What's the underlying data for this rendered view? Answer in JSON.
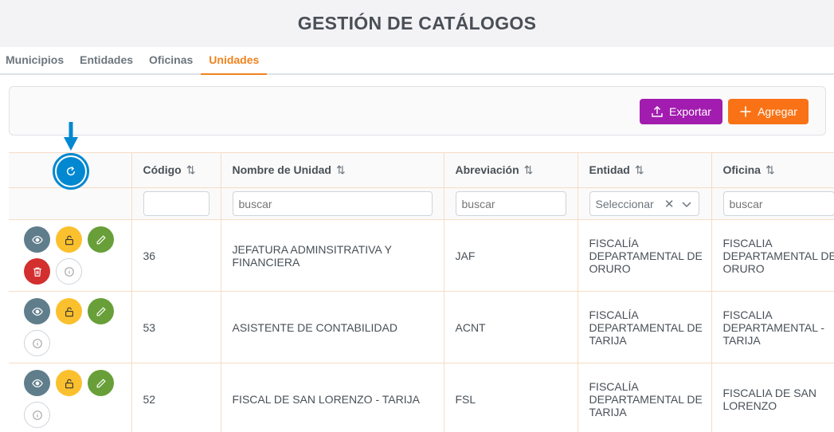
{
  "header": {
    "title": "GESTIÓN DE CATÁLOGOS"
  },
  "tabs": [
    {
      "label": "Municipios",
      "active": false
    },
    {
      "label": "Entidades",
      "active": false
    },
    {
      "label": "Oficinas",
      "active": false
    },
    {
      "label": "Unidades",
      "active": true
    }
  ],
  "toolbar": {
    "export_label": "Exportar",
    "add_label": "Agregar"
  },
  "table": {
    "columns": [
      {
        "label": "Código"
      },
      {
        "label": "Nombre de Unidad"
      },
      {
        "label": "Abreviación"
      },
      {
        "label": "Entidad"
      },
      {
        "label": "Oficina"
      }
    ],
    "filters": {
      "nombre_placeholder": "buscar",
      "abreviacion_placeholder": "buscar",
      "entidad_select": "Seleccionar",
      "oficina_placeholder": "buscar"
    },
    "rows": [
      {
        "codigo": "36",
        "nombre": "JEFATURA ADMINSITRATIVA Y FINANCIERA",
        "abreviacion": "JAF",
        "entidad": "FISCALÍA DEPARTAMENTAL DE ORURO",
        "oficina": "FISCALIA DEPARTAMENTAL DE ORURO"
      },
      {
        "codigo": "53",
        "nombre": "ASISTENTE DE CONTABILIDAD",
        "abreviacion": "ACNT",
        "entidad": "FISCALÍA DEPARTAMENTAL DE TARIJA",
        "oficina": "FISCALIA DEPARTAMENTAL - TARIJA"
      },
      {
        "codigo": "52",
        "nombre": "FISCAL DE SAN LORENZO - TARIJA",
        "abreviacion": "FSL",
        "entidad": "FISCALÍA DEPARTAMENTAL DE TARIJA",
        "oficina": "FISCALIA DE SAN LORENZO"
      }
    ]
  },
  "colors": {
    "accent": "#f0831e",
    "export": "#a21caf",
    "add": "#f97316",
    "refresh": "#0288d1"
  }
}
